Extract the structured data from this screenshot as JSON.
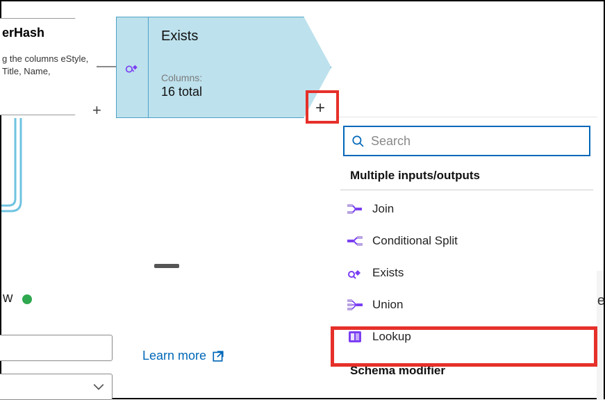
{
  "left_node": {
    "title_fragment": "erHash",
    "desc_fragment": "g the columns eStyle, Title, Name,"
  },
  "exists_node": {
    "title": "Exists",
    "columns_label": "Columns:",
    "columns_value": "16 total"
  },
  "search": {
    "placeholder": "Search"
  },
  "section1_title": "Multiple inputs/outputs",
  "section2_title": "Schema modifier",
  "menu": {
    "join": "Join",
    "conditional_split": "Conditional Split",
    "exists": "Exists",
    "union": "Union",
    "lookup": "Lookup"
  },
  "learn_more": "Learn more",
  "bottom_status_letter": "w",
  "right_cut_letter": "e"
}
